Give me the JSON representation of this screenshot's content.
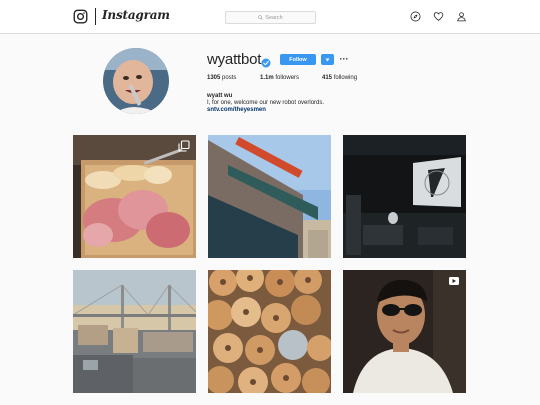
{
  "nav": {
    "wordmark": "Instagram",
    "search_placeholder": "Search",
    "icons": [
      "instagram-glyph-icon",
      "compass-icon",
      "heart-icon",
      "person-icon"
    ]
  },
  "profile": {
    "username": "wyattbot",
    "verified": true,
    "follow_label": "Follow",
    "more_label": "···",
    "stats": {
      "posts_value": "1305",
      "posts_label": "posts",
      "followers_value": "1.1m",
      "followers_label": "followers",
      "following_value": "415",
      "following_label": "following"
    },
    "full_name": "wyatt wu",
    "bio": "I, for one, welcome our new robot overlords.",
    "link": "sntv.com/theyesmen"
  },
  "posts": [
    {
      "subject": "charcuterie board",
      "badge": "carousel-icon"
    },
    {
      "subject": "building with neon sign",
      "badge": ""
    },
    {
      "subject": "dark screening room",
      "badge": ""
    },
    {
      "subject": "bridge over city",
      "badge": ""
    },
    {
      "subject": "pile of bagels",
      "badge": ""
    },
    {
      "subject": "man with sunglasses",
      "badge": "video-icon"
    }
  ],
  "colors": {
    "accent": "#3897f0",
    "link": "#003569",
    "verified": "#3897f0",
    "background": "#fafafa",
    "border": "#dbdbdb"
  }
}
